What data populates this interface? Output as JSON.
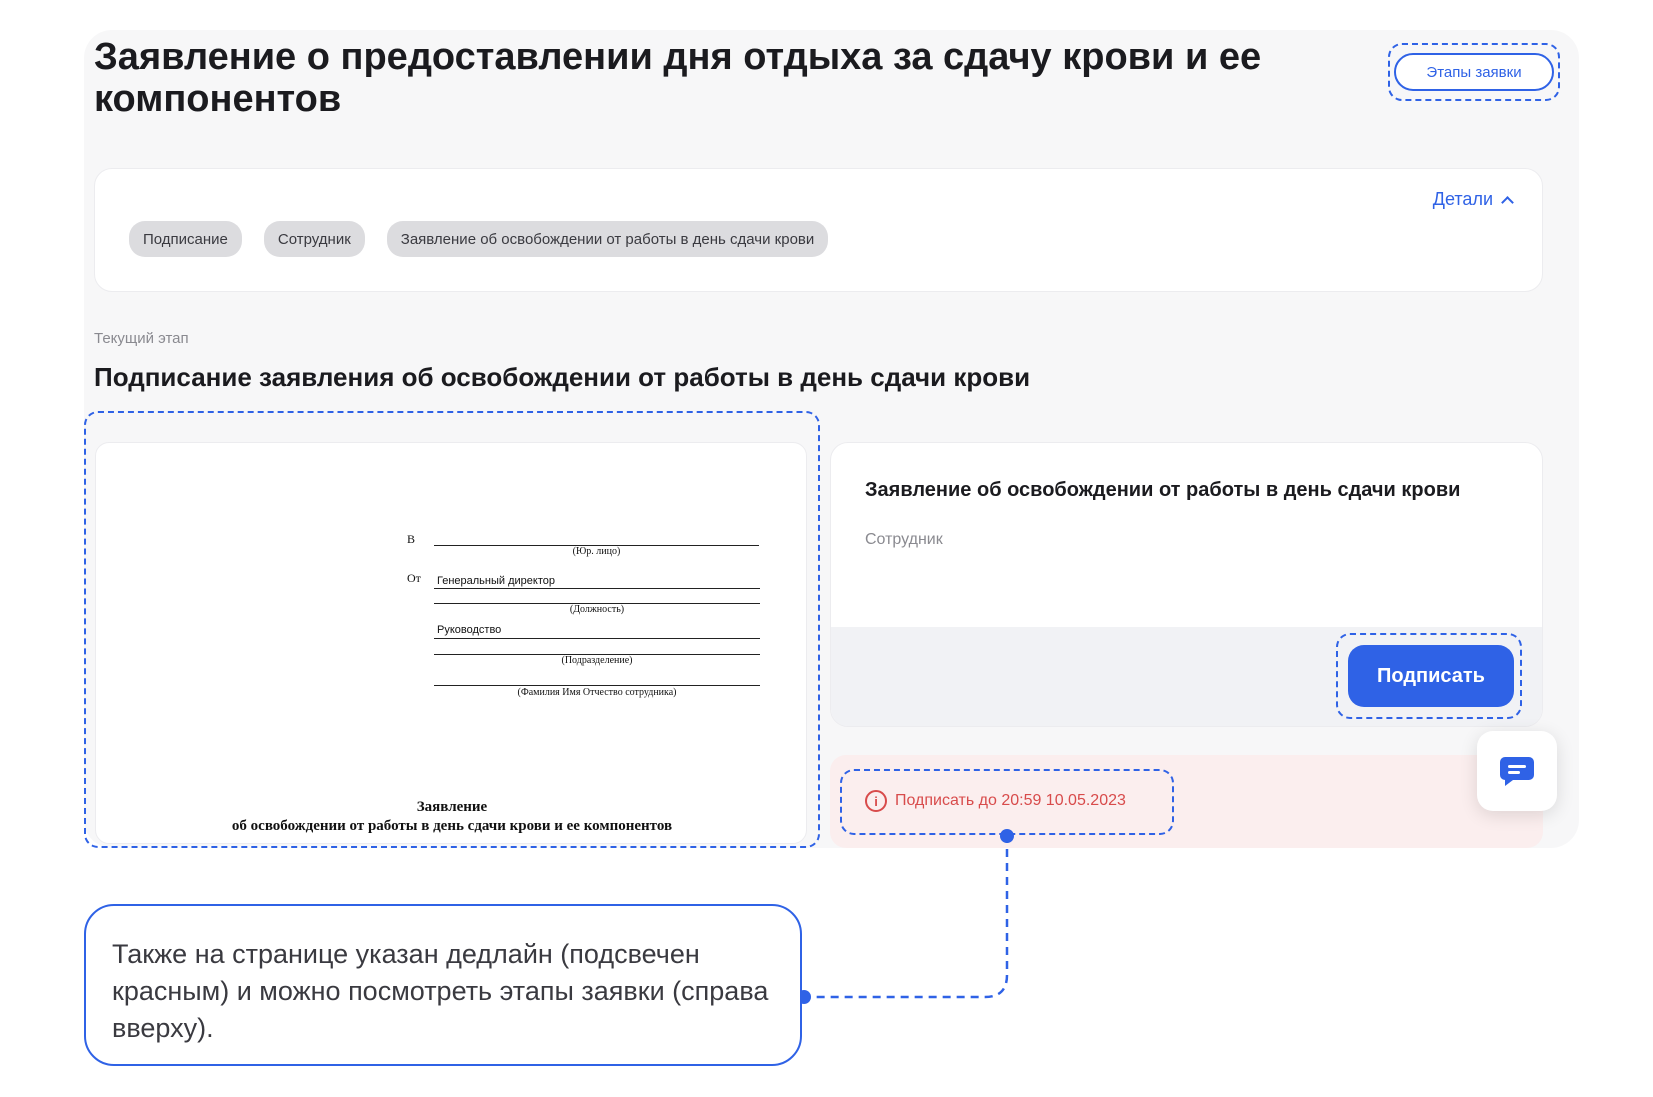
{
  "header": {
    "title": "Заявление о предоставлении дня отдыха за сдачу крови и ее компонентов",
    "stages_button": "Этапы заявки"
  },
  "info_card": {
    "details_label": "Детали",
    "tags": [
      "Подписание",
      "Сотрудник",
      "Заявление об освобождении от работы в день сдачи крови"
    ]
  },
  "stage": {
    "label": "Текущий этап",
    "title": "Подписание заявления об освобождении от работы в день сдачи крови"
  },
  "document_preview": {
    "to_prefix": "В",
    "to_caption": "(Юр. лицо)",
    "from_prefix": "От",
    "position_value": "Генеральный директор",
    "position_caption": "(Должность)",
    "department_value": "Руководство",
    "department_caption": "(Подразделение)",
    "name_caption": "(Фамилия Имя Отчество сотрудника)",
    "heading": "Заявление",
    "subheading": "об освобождении от работы в день сдачи крови и ее компонентов"
  },
  "sign_card": {
    "title": "Заявление об освобождении от работы в день сдачи крови",
    "subtitle": "Сотрудник",
    "sign_button": "Подписать"
  },
  "deadline": {
    "text": "Подписать до 20:59 10.05.2023"
  },
  "callout": {
    "text": "Также на странице указан дедлайн (подсвечен красным) и можно посмотреть этапы заявки (справа вверху)."
  },
  "colors": {
    "accent": "#2f62e6",
    "deadline_red": "#d84b4b",
    "deadline_bg": "#fbeeee"
  },
  "icons": {
    "details": "chevron-up-icon",
    "deadline": "info-icon",
    "chat": "chat-icon"
  }
}
